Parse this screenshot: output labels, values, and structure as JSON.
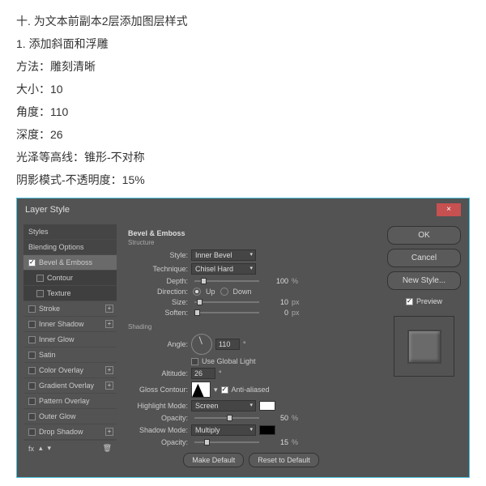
{
  "instructions": {
    "line1": "十. 为文本前副本2层添加图层样式",
    "line2": "1. 添加斜面和浮雕",
    "line3": "方法：雕刻清晰",
    "line4": "大小：10",
    "line5": "角度：110",
    "line6": "深度：26",
    "line7": "光泽等高线：锥形-不对称",
    "line8": "阴影模式-不透明度：15%"
  },
  "dialog": {
    "title": "Layer Style",
    "close": "×"
  },
  "styles": {
    "header1": "Styles",
    "header2": "Blending Options",
    "bevel": "Bevel & Emboss",
    "contour": "Contour",
    "texture": "Texture",
    "stroke": "Stroke",
    "innerShadow": "Inner Shadow",
    "innerGlow": "Inner Glow",
    "satin": "Satin",
    "colorOverlay": "Color Overlay",
    "gradientOverlay": "Gradient Overlay",
    "patternOverlay": "Pattern Overlay",
    "outerGlow": "Outer Glow",
    "dropShadow": "Drop Shadow",
    "fx": "fx"
  },
  "panel": {
    "sectionTitle": "Bevel & Emboss",
    "structure": "Structure",
    "styleLabel": "Style:",
    "styleValue": "Inner Bevel",
    "techniqueLabel": "Technique:",
    "techniqueValue": "Chisel Hard",
    "depthLabel": "Depth:",
    "depthValue": "100",
    "pctUnit": "%",
    "directionLabel": "Direction:",
    "upLabel": "Up",
    "downLabel": "Down",
    "sizeLabel": "Size:",
    "sizeValue": "10",
    "pxUnit": "px",
    "softenLabel": "Soften:",
    "softenValue": "0",
    "shading": "Shading",
    "angleLabel": "Angle:",
    "angleValue": "110",
    "globalLight": "Use Global Light",
    "altitudeLabel": "Altitude:",
    "altitudeValue": "26",
    "glossLabel": "Gloss Contour:",
    "antiAliased": "Anti-aliased",
    "highlightLabel": "Highlight Mode:",
    "highlightValue": "Screen",
    "highlightOpacity": "50",
    "opacityLabel": "Opacity:",
    "shadowLabel": "Shadow Mode:",
    "shadowValue": "Multiply",
    "shadowOpacity": "15",
    "makeDefault": "Make Default",
    "resetDefault": "Reset to Default"
  },
  "right": {
    "ok": "OK",
    "cancel": "Cancel",
    "newStyle": "New Style...",
    "preview": "Preview"
  },
  "colors": {
    "highlight": "#ffffff",
    "shadow": "#000000"
  }
}
